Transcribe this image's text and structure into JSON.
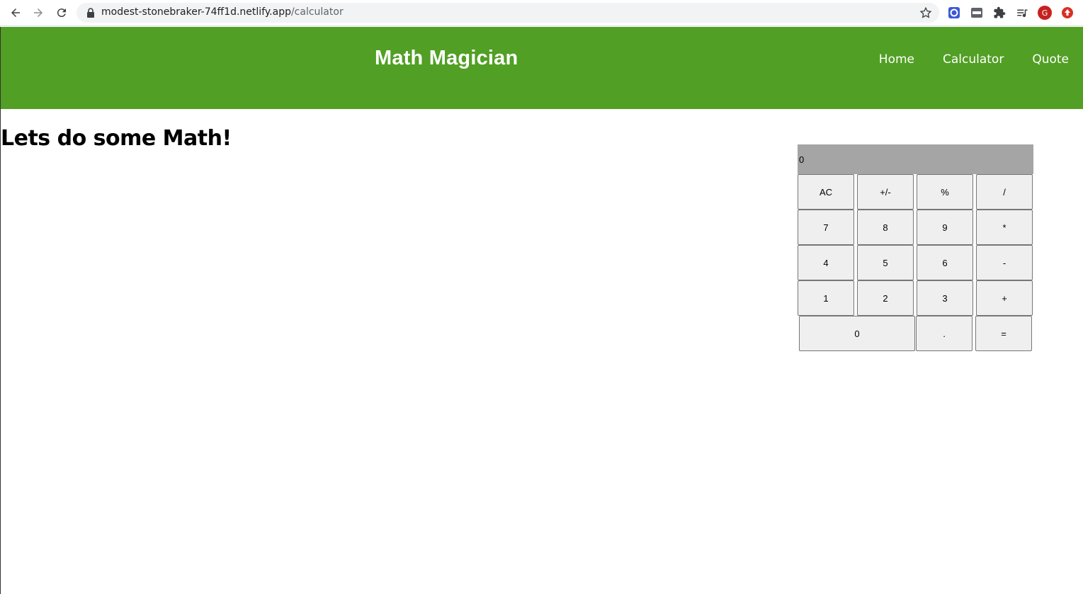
{
  "browser": {
    "url_host": "modest-stonebraker-74ff1d.netlify.app",
    "url_path": "/calculator",
    "profile_initial": "G"
  },
  "header": {
    "brand": "Math Magician",
    "nav": [
      {
        "label": "Home"
      },
      {
        "label": "Calculator"
      },
      {
        "label": "Quote"
      }
    ],
    "bg_color": "#519f24"
  },
  "main": {
    "title": "Lets do some Math!"
  },
  "calculator": {
    "display_value": "0",
    "rows": [
      [
        "AC",
        "+/-",
        "%",
        "/"
      ],
      [
        "7",
        "8",
        "9",
        "*"
      ],
      [
        "4",
        "5",
        "6",
        "-"
      ],
      [
        "1",
        "2",
        "3",
        "+"
      ],
      [
        "0",
        ".",
        "="
      ]
    ]
  }
}
